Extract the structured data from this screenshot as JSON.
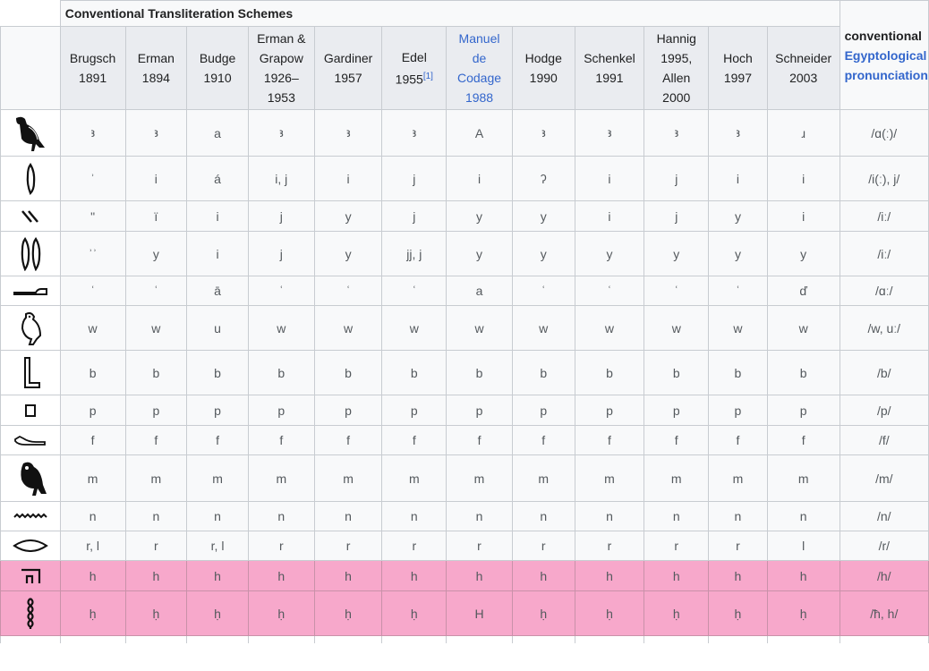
{
  "table": {
    "caption": "Conventional Transliteration Schemes",
    "pron_header": {
      "line1": "conventional",
      "line2": "Egyptological",
      "line3": "pronunciation"
    },
    "schemes": [
      {
        "lines": [
          "Brugsch",
          "1891"
        ]
      },
      {
        "lines": [
          "Erman",
          "1894"
        ]
      },
      {
        "lines": [
          "Budge",
          "1910"
        ]
      },
      {
        "lines": [
          "Erman &",
          "Grapow",
          "1926–",
          "1953"
        ]
      },
      {
        "lines": [
          "Gardiner",
          "1957"
        ]
      },
      {
        "lines": [
          "Edel",
          "1955"
        ],
        "sup": "[1]"
      },
      {
        "lines": [
          "Manuel",
          "de",
          "Codage",
          "1988"
        ],
        "link": true
      },
      {
        "lines": [
          "Hodge",
          "1990"
        ]
      },
      {
        "lines": [
          "Schenkel",
          "1991"
        ]
      },
      {
        "lines": [
          "Hannig",
          "1995,",
          "Allen",
          "2000"
        ]
      },
      {
        "lines": [
          "Hoch",
          "1997"
        ]
      },
      {
        "lines": [
          "Schneider",
          "2003"
        ]
      }
    ],
    "rows": [
      {
        "glyph": "vulture-glyph",
        "values": [
          "ꜣ",
          "ꜣ",
          "a",
          "ꜣ",
          "ꜣ",
          "ꜣ",
          "A",
          "ꜣ",
          "ꜣ",
          "ꜣ",
          "ꜣ",
          "ɹ"
        ],
        "pron": "/ɑ(ː)/"
      },
      {
        "glyph": "reed-glyph",
        "values": [
          "ʾ",
          "i",
          "á",
          "i, j",
          "i",
          "j",
          "i",
          "ʔ",
          "i",
          "j",
          "i",
          "i"
        ],
        "pron": "/i(ː), j/"
      },
      {
        "glyph": "strokes-glyph",
        "values": [
          "ʺ",
          "ï",
          "i",
          "j",
          "y",
          "j",
          "y",
          "y",
          "i",
          "j",
          "y",
          "i"
        ],
        "pron": "/iː/"
      },
      {
        "glyph": "double-reed-glyph",
        "values": [
          "ʾʾ",
          "y",
          "i",
          "j",
          "y",
          "jj, j",
          "y",
          "y",
          "y",
          "y",
          "y",
          "y"
        ],
        "pron": "/iː/"
      },
      {
        "glyph": "arm-glyph",
        "values": [
          "ʿ",
          "ʿ",
          "ā",
          "ʿ",
          "ʿ",
          "ʿ",
          "a",
          "ʿ",
          "ʿ",
          "ʿ",
          "ʿ",
          "ď"
        ],
        "pron": "/ɑː/"
      },
      {
        "glyph": "quail-chick-glyph",
        "values": [
          "w",
          "w",
          "u",
          "w",
          "w",
          "w",
          "w",
          "w",
          "w",
          "w",
          "w",
          "w"
        ],
        "pron": "/w, uː/"
      },
      {
        "glyph": "foot-glyph",
        "values": [
          "b",
          "b",
          "b",
          "b",
          "b",
          "b",
          "b",
          "b",
          "b",
          "b",
          "b",
          "b"
        ],
        "pron": "/b/"
      },
      {
        "glyph": "stool-glyph",
        "values": [
          "p",
          "p",
          "p",
          "p",
          "p",
          "p",
          "p",
          "p",
          "p",
          "p",
          "p",
          "p"
        ],
        "pron": "/p/"
      },
      {
        "glyph": "horned-viper-glyph",
        "values": [
          "f",
          "f",
          "f",
          "f",
          "f",
          "f",
          "f",
          "f",
          "f",
          "f",
          "f",
          "f"
        ],
        "pron": "/f/"
      },
      {
        "glyph": "owl-glyph",
        "values": [
          "m",
          "m",
          "m",
          "m",
          "m",
          "m",
          "m",
          "m",
          "m",
          "m",
          "m",
          "m"
        ],
        "pron": "/m/"
      },
      {
        "glyph": "water-glyph",
        "values": [
          "n",
          "n",
          "n",
          "n",
          "n",
          "n",
          "n",
          "n",
          "n",
          "n",
          "n",
          "n"
        ],
        "pron": "/n/"
      },
      {
        "glyph": "mouth-glyph",
        "values": [
          "r, l",
          "r",
          "r, l",
          "r",
          "r",
          "r",
          "r",
          "r",
          "r",
          "r",
          "r",
          "l"
        ],
        "pron": "/r/"
      },
      {
        "glyph": "reed-shelter-glyph",
        "values": [
          "h",
          "h",
          "h",
          "h",
          "h",
          "h",
          "h",
          "h",
          "h",
          "h",
          "h",
          "h"
        ],
        "pron": "/h/",
        "highlight": true
      },
      {
        "glyph": "twisted-wick-glyph",
        "values": [
          "ḥ",
          "ḥ",
          "ḥ",
          "ḥ",
          "ḥ",
          "ḥ",
          "H",
          "ḥ",
          "ḥ",
          "ḥ",
          "ḥ",
          "ḥ"
        ],
        "pron": "/ħ, h/",
        "highlight": true
      }
    ]
  },
  "colors": {
    "header_bg": "#eaecf0",
    "cell_bg": "#f8f9fa",
    "border": "#c8ccd1",
    "link": "#3366cc",
    "highlight": "#f7a8cb"
  }
}
